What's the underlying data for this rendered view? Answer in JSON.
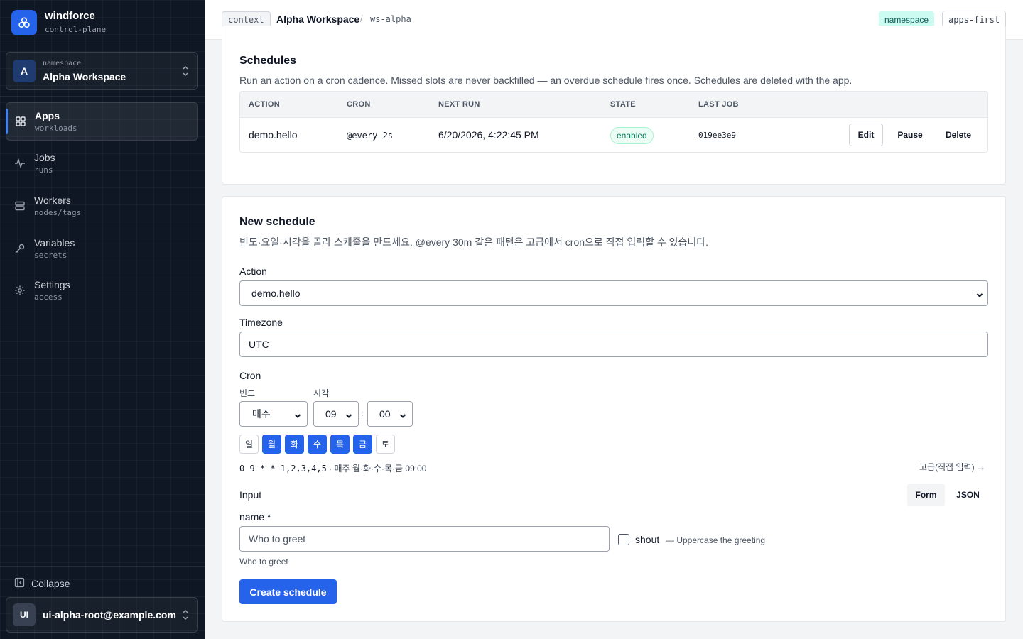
{
  "brand": {
    "name": "windforce",
    "subtitle": "control-plane"
  },
  "namespace_switcher": {
    "label": "namespace",
    "avatar": "A",
    "name": "Alpha Workspace"
  },
  "nav": [
    {
      "label": "Apps",
      "sub": "workloads",
      "icon": "grid-icon",
      "active": true
    },
    {
      "label": "Jobs",
      "sub": "runs",
      "icon": "activity-icon",
      "active": false
    },
    {
      "label": "Workers",
      "sub": "nodes/tags",
      "icon": "server-icon",
      "active": false
    },
    {
      "label": "Variables",
      "sub": "secrets",
      "icon": "key-icon",
      "active": false
    },
    {
      "label": "Settings",
      "sub": "access",
      "icon": "gear-icon",
      "active": false
    }
  ],
  "sidebar_footer": {
    "collapse": "Collapse",
    "user_avatar": "UI",
    "user_email": "ui-alpha-root@example.com"
  },
  "topbar": {
    "context_chip": "context",
    "workspace": "Alpha Workspace",
    "separator": "/",
    "slug": "ws-alpha",
    "tags": [
      "namespace",
      "apps-first"
    ]
  },
  "schedules": {
    "title": "Schedules",
    "description": "Run an action on a cron cadence. Missed slots are never backfilled — an overdue schedule fires once. Schedules are deleted with the app.",
    "columns": [
      "ACTION",
      "CRON",
      "NEXT RUN",
      "STATE",
      "LAST JOB"
    ],
    "rows": [
      {
        "action": "demo.hello",
        "cron": "@every 2s",
        "next_run": "6/20/2026, 4:22:45 PM",
        "state": "enabled",
        "last_job": "019ee3e9",
        "actions": [
          "Edit",
          "Pause",
          "Delete"
        ]
      }
    ]
  },
  "new_schedule": {
    "title": "New schedule",
    "description": "빈도·요일·시각을 골라 스케줄을 만드세요. @every 30m 같은 패턴은 고급에서 cron으로 직접 입력할 수 있습니다.",
    "action_label": "Action",
    "action_value": "demo.hello",
    "timezone_label": "Timezone",
    "timezone_value": "UTC",
    "cron_label": "Cron",
    "frequency_label": "빈도",
    "frequency_value": "매주",
    "time_label": "시각",
    "hour_value": "09",
    "time_separator": ":",
    "minute_value": "00",
    "days": [
      {
        "label": "일",
        "selected": false
      },
      {
        "label": "월",
        "selected": true
      },
      {
        "label": "화",
        "selected": true
      },
      {
        "label": "수",
        "selected": true
      },
      {
        "label": "목",
        "selected": true
      },
      {
        "label": "금",
        "selected": true
      },
      {
        "label": "토",
        "selected": false
      }
    ],
    "cron_expression": "0 9 * * 1,2,3,4,5",
    "cron_human": " · 매주 월·화·수·목·금 09:00",
    "advanced_link": "고급(직접 입력) →",
    "input_label": "Input",
    "input_modes": [
      "Form",
      "JSON"
    ],
    "active_mode": "Form",
    "name_label": "name *",
    "name_placeholder": "Who to greet",
    "name_help": "Who to greet",
    "shout_label": "shout",
    "shout_hint": "— Uppercase the greeting",
    "shout_checked": false,
    "submit": "Create schedule"
  },
  "colors": {
    "accent": "#2563eb",
    "sidebar_bg": "#0f1724",
    "ns_tag_bg": "#ccfbf1",
    "enabled_green": "#047857"
  }
}
